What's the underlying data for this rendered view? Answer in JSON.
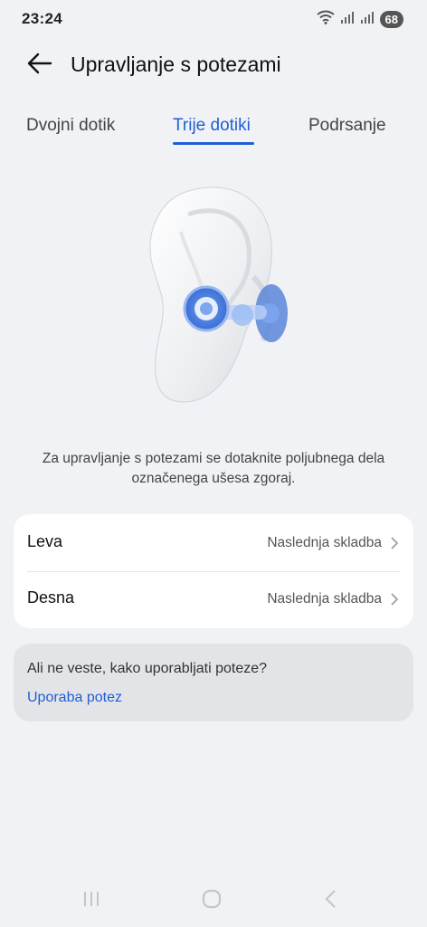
{
  "status_bar": {
    "time": "23:24",
    "battery": "68"
  },
  "header": {
    "title": "Upravljanje s potezami"
  },
  "tabs": [
    {
      "label": "Dvojni dotik",
      "active": false
    },
    {
      "label": "Trije dotiki",
      "active": true
    },
    {
      "label": "Podrsanje",
      "active": false
    }
  ],
  "hint": "Za upravljanje s potezami se dotaknite poljubnega dela označenega ušesa zgoraj.",
  "settings": {
    "rows": [
      {
        "label": "Leva",
        "value": "Naslednja skladba"
      },
      {
        "label": "Desna",
        "value": "Naslednja skladba"
      }
    ]
  },
  "help": {
    "question": "Ali ne veste, kako uporabljati poteze?",
    "link": "Uporaba potez"
  },
  "colors": {
    "accent": "#1f5fd6",
    "background": "#f1f2f6",
    "card": "#ffffff",
    "help_card": "#e3e4e8"
  }
}
